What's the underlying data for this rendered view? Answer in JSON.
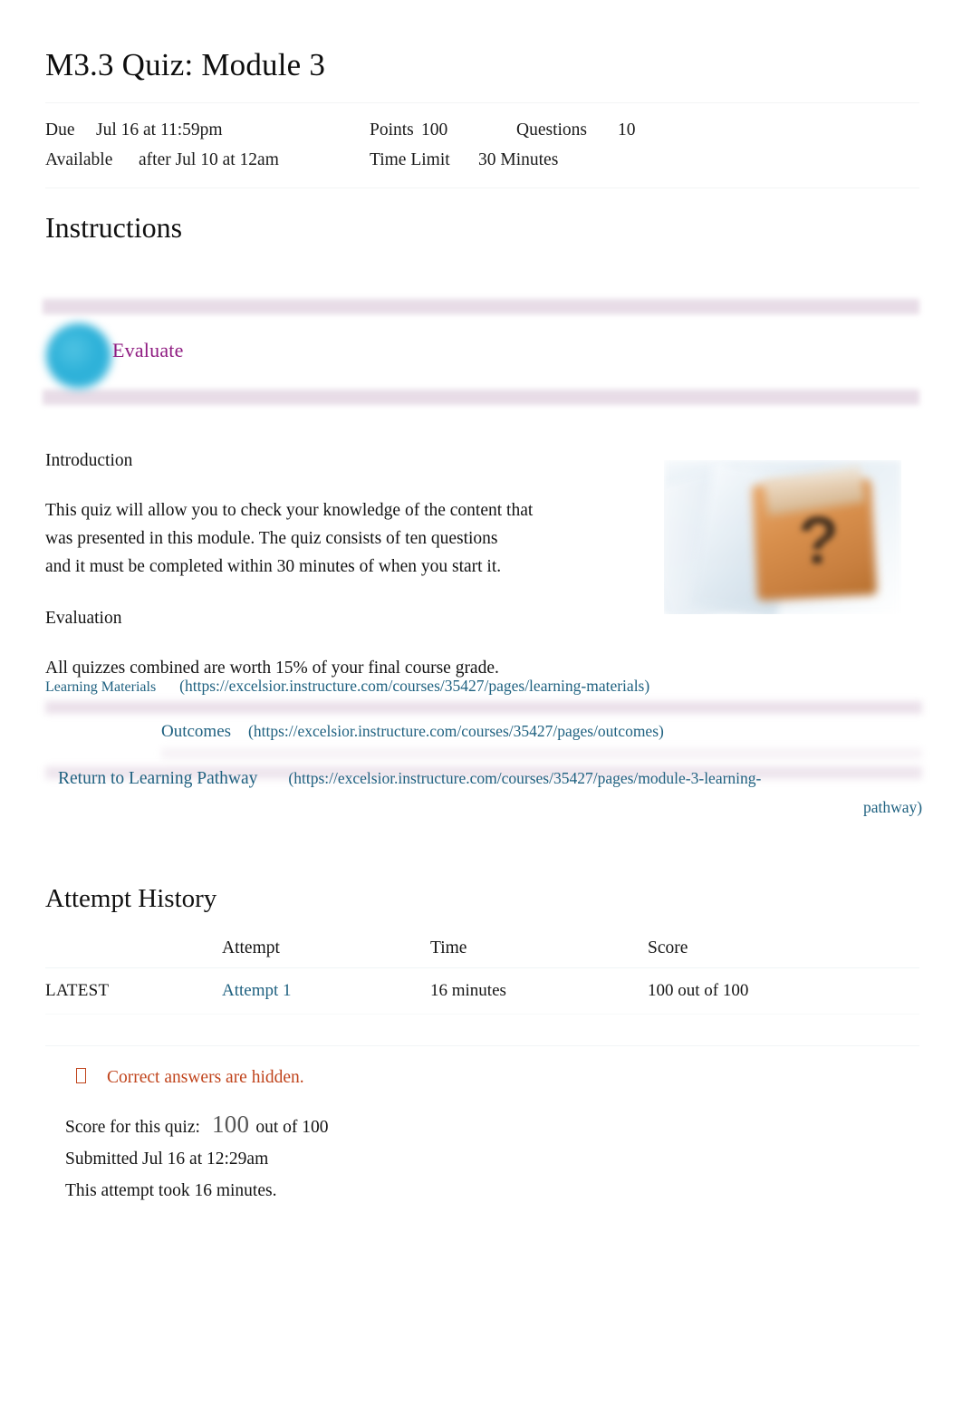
{
  "quiz": {
    "title": "M3.3 Quiz: Module 3",
    "meta": {
      "due_label": "Due",
      "due_value": "Jul 16 at 11:59pm",
      "points_label": "Points",
      "points_value": "100",
      "questions_label": "Questions",
      "questions_value": "10",
      "available_label": "Available",
      "available_value": "after Jul 10 at 12am",
      "time_limit_label": "Time Limit",
      "time_limit_value": "30 Minutes"
    }
  },
  "instructions": {
    "heading": "Instructions",
    "banner": {
      "label": "Evaluate",
      "icon": "circle-icon",
      "label_color": "#8e1a80",
      "circle_color": "#2bb0d8",
      "stripe_color": "#e7dbe6"
    },
    "intro_heading": "Introduction",
    "intro_body_line1": "This quiz will allow you to check your knowledge of the content that",
    "intro_body_line2": "was presented in this module. The quiz consists of ten questions",
    "intro_body_line3": "and it must be completed within 30 minutes of when you start it.",
    "evaluation_heading": "Evaluation",
    "evaluation_body": "All quizzes combined are worth 15% of your final course grade.",
    "image_alt": "question-mark-box-image"
  },
  "links": [
    {
      "label": "Learning Materials",
      "url": "(https://excelsior.instructure.com/courses/35427/pages/learning-materials)"
    },
    {
      "label": "Outcomes",
      "url": "(https://excelsior.instructure.com/courses/35427/pages/outcomes)"
    },
    {
      "label": "Return to Learning Pathway",
      "url": "(https://excelsior.instructure.com/courses/35427/pages/module-3-learning-",
      "url_tail": "pathway)"
    }
  ],
  "attempt_history": {
    "heading": "Attempt History",
    "columns": [
      "",
      "Attempt",
      "Time",
      "Score"
    ],
    "rows": [
      {
        "kept": "LATEST",
        "attempt": "Attempt 1",
        "time": "16 minutes",
        "score": "100 out of 100"
      }
    ]
  },
  "notice": {
    "icon": "missing-glyph-icon",
    "text": "Correct answers are hidden.",
    "color": "#c0441c"
  },
  "score_summary": {
    "label": "Score for this quiz:",
    "score": "100",
    "out_of": "out of 100",
    "submitted": "Submitted Jul 16 at 12:29am",
    "duration": "This attempt took 16 minutes."
  },
  "colors": {
    "link": "#1f6180",
    "accent_purple": "#8e1a80",
    "accent_cyan": "#2bb0d8",
    "warning": "#c0441c"
  }
}
